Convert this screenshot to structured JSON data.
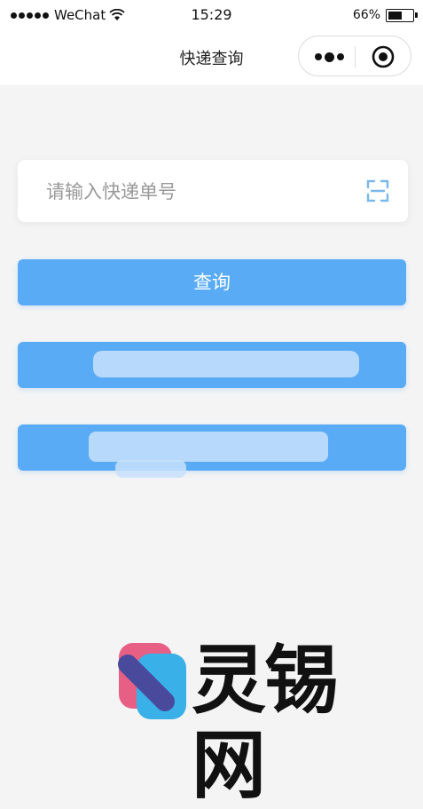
{
  "status_bar": {
    "carrier": "WeChat",
    "time": "15:29",
    "battery_percent": "66%",
    "battery_level": 0.66,
    "signal_dots": 5
  },
  "nav": {
    "title": "快递查询",
    "more_icon": "more-dots-icon",
    "close_icon": "target-close-icon"
  },
  "search": {
    "placeholder": "请输入快递单号",
    "value": "",
    "scan_icon": "scan-icon"
  },
  "buttons": {
    "query_label": "查询",
    "button2_label": "",
    "button3_label": ""
  },
  "watermark": {
    "text": "灵锡网"
  },
  "colors": {
    "background": "#f4f4f4",
    "primary": "#5aabf5",
    "scan_icon": "#7ab8ec"
  }
}
